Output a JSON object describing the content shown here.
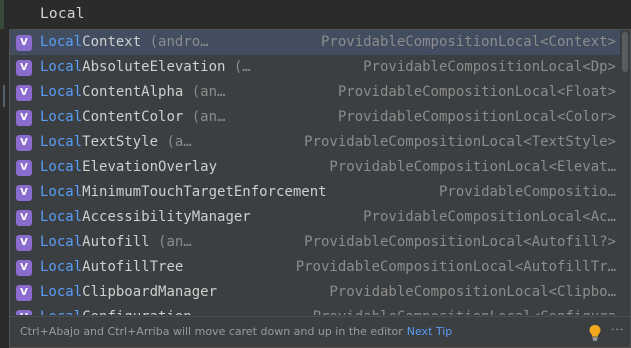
{
  "editor": {
    "typed_text": "Local"
  },
  "completion": {
    "match_prefix": "Local",
    "items": [
      {
        "suffix": "Context",
        "hint": " (andro…",
        "type": "ProvidableCompositionLocal<Context>",
        "selected": true
      },
      {
        "suffix": "AbsoluteElevation",
        "hint": " (…",
        "type": "ProvidableCompositionLocal<Dp>"
      },
      {
        "suffix": "ContentAlpha",
        "hint": " (an…",
        "type": "ProvidableCompositionLocal<Float>"
      },
      {
        "suffix": "ContentColor",
        "hint": " (an…",
        "type": "ProvidableCompositionLocal<Color>"
      },
      {
        "suffix": "TextStyle",
        "hint": " (a…",
        "type": "ProvidableCompositionLocal<TextStyle>"
      },
      {
        "suffix": "ElevationOverlay",
        "hint": "",
        "type": "ProvidableCompositionLocal<Elevat…"
      },
      {
        "suffix": "MinimumTouchTargetEnforcement",
        "hint": "",
        "type": "ProvidableCompositio…"
      },
      {
        "suffix": "AccessibilityManager",
        "hint": "",
        "type": "ProvidableCompositionLocal<Ac…"
      },
      {
        "suffix": "Autofill",
        "hint": " (an…",
        "type": "ProvidableCompositionLocal<Autofill?>"
      },
      {
        "suffix": "AutofillTree",
        "hint": "",
        "type": "ProvidableCompositionLocal<AutofillTr…"
      },
      {
        "suffix": "ClipboardManager",
        "hint": "",
        "type": "ProvidableCompositionLocal<Clipbo…"
      },
      {
        "suffix": "Configuration",
        "hint": "",
        "type": "ProvidableCompositionLocal<Configura"
      }
    ],
    "kind_icon_letter": "V",
    "kind_icon_color": "#8a6ccf",
    "match_color": "#589df6"
  },
  "footer": {
    "message": "Ctrl+Abajo and Ctrl+Arriba will move caret down and up in the editor",
    "next_tip_label": "Next Tip",
    "bulb_icon": "lightbulb-icon",
    "more_icon": "more-vertical-icon"
  }
}
